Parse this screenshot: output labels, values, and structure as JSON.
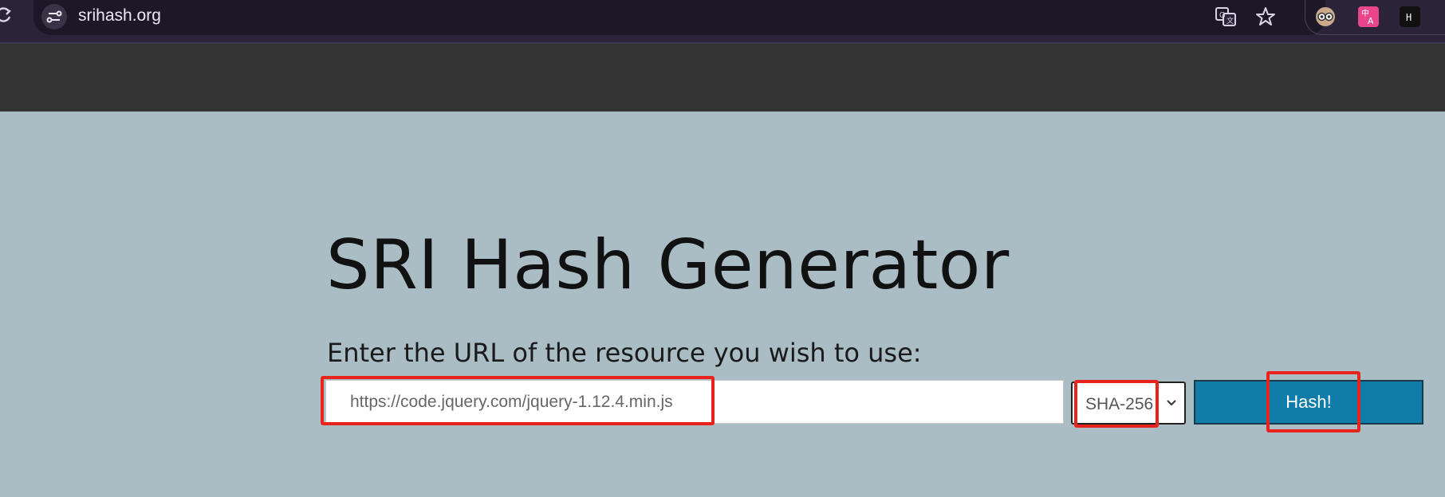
{
  "browser": {
    "url": "srihash.org",
    "icons": [
      "reload-icon",
      "site-info-icon",
      "translate-icon",
      "bookmark-star-icon"
    ],
    "extensions": [
      "owl-extension-icon",
      "translate-extension-icon",
      "h-extension-icon"
    ]
  },
  "page": {
    "title": "SRI Hash Generator",
    "prompt": "Enter the URL of the resource you wish to use:",
    "url_input": {
      "placeholder": "https://code.jquery.com/jquery-1.12.4.min.js",
      "value": ""
    },
    "algorithm": {
      "selected": "SHA-256"
    },
    "hash_button": "Hash!"
  },
  "colors": {
    "background": "#aabcc4",
    "navbar": "#333333",
    "button": "#0f7ca9",
    "annotation": "#e8231c"
  }
}
